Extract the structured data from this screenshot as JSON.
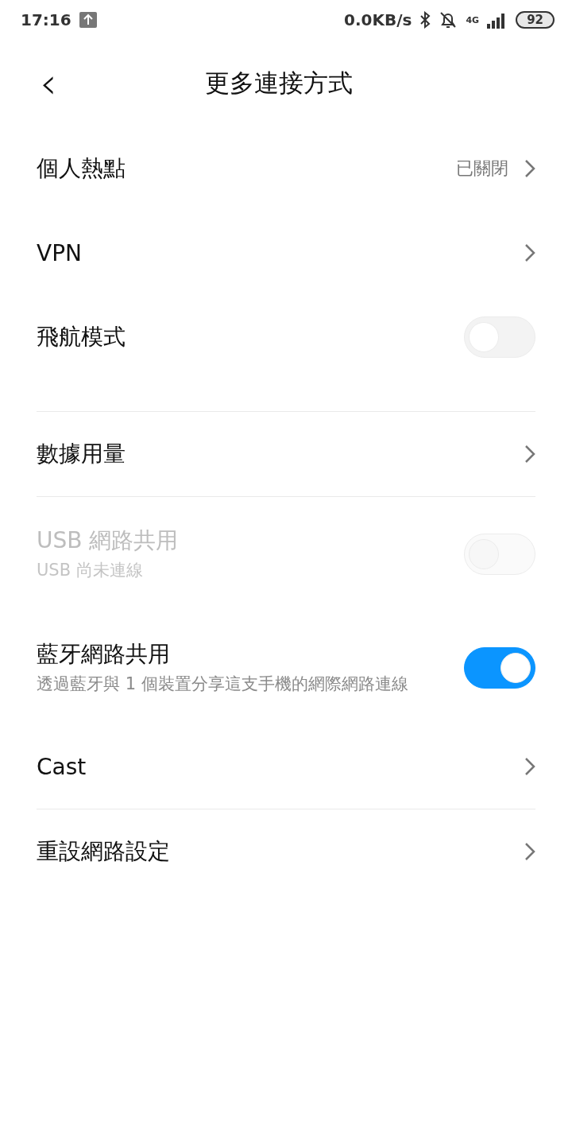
{
  "status_bar": {
    "time": "17:16",
    "speed": "0.0KB/s",
    "network": "4G",
    "battery": "92"
  },
  "header": {
    "back": "‹",
    "title": "更多連接方式"
  },
  "groups": [
    {
      "items": [
        {
          "kind": "nav",
          "title": "個人熱點",
          "value": "已關閉",
          "disabled": false
        },
        {
          "kind": "nav",
          "title": "VPN",
          "disabled": false
        },
        {
          "kind": "toggle",
          "title": "飛航模式",
          "on": false,
          "disabled": false
        }
      ]
    },
    {
      "items": [
        {
          "kind": "nav",
          "title": "數據用量",
          "disabled": false
        }
      ]
    },
    {
      "items": [
        {
          "kind": "toggle",
          "title": "USB 網路共用",
          "subtitle": "USB 尚未連線",
          "on": false,
          "disabled": true
        },
        {
          "kind": "toggle",
          "title": "藍牙網路共用",
          "subtitle": "透過藍牙與 1 個裝置分享這支手機的網際網路連線",
          "on": true,
          "disabled": false
        },
        {
          "kind": "nav",
          "title": "Cast",
          "disabled": false
        }
      ]
    },
    {
      "items": [
        {
          "kind": "nav",
          "title": "重設網路設定",
          "disabled": false
        }
      ]
    }
  ]
}
